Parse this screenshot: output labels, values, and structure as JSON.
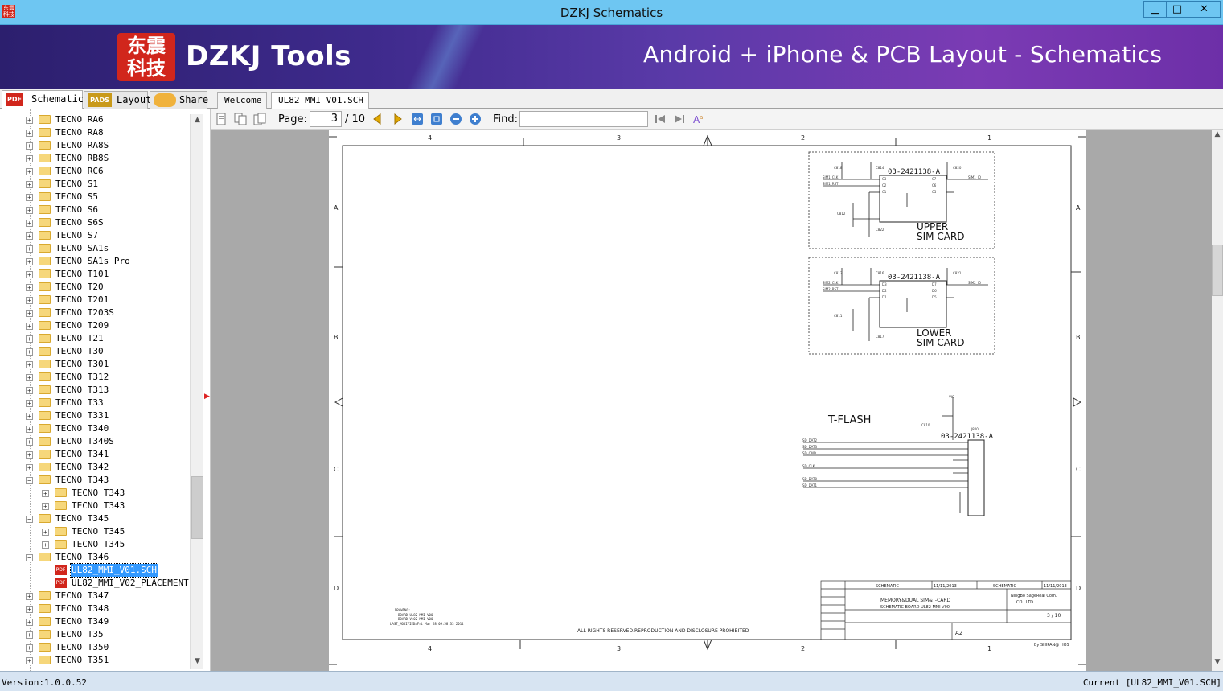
{
  "window": {
    "title": "DZKJ Schematics",
    "icon_text": "东震科技",
    "minimize": "▁",
    "maximize": "□",
    "close": "✕"
  },
  "banner": {
    "logo_text": "东震\n科技",
    "brand": "DZKJ Tools",
    "tagline": "Android + iPhone & PCB Layout - Schematics"
  },
  "left_tabs": [
    {
      "label": "Schematic",
      "icon": "pdf-icon",
      "icon_text": "PDF",
      "active": true
    },
    {
      "label": "Layout",
      "icon": "pads-icon",
      "icon_text": "PADS",
      "active": false
    },
    {
      "label": "Share",
      "icon": "cloud-share-icon",
      "icon_text": "",
      "active": false
    }
  ],
  "doc_tabs": [
    {
      "label": "Welcome",
      "active": false,
      "closable": false
    },
    {
      "label": "UL82_MMI_V01.SCH",
      "active": true,
      "closable": true
    }
  ],
  "tree": {
    "items": [
      {
        "label": "TECNO RA6",
        "level": 1,
        "type": "folder",
        "expand": "+"
      },
      {
        "label": "TECNO RA8",
        "level": 1,
        "type": "folder",
        "expand": "+"
      },
      {
        "label": "TECNO RA8S",
        "level": 1,
        "type": "folder",
        "expand": "+"
      },
      {
        "label": "TECNO RB8S",
        "level": 1,
        "type": "folder",
        "expand": "+"
      },
      {
        "label": "TECNO RC6",
        "level": 1,
        "type": "folder",
        "expand": "+"
      },
      {
        "label": "TECNO S1",
        "level": 1,
        "type": "folder",
        "expand": "+"
      },
      {
        "label": "TECNO S5",
        "level": 1,
        "type": "folder",
        "expand": "+"
      },
      {
        "label": "TECNO S6",
        "level": 1,
        "type": "folder",
        "expand": "+"
      },
      {
        "label": "TECNO S6S",
        "level": 1,
        "type": "folder",
        "expand": "+"
      },
      {
        "label": "TECNO S7",
        "level": 1,
        "type": "folder",
        "expand": "+"
      },
      {
        "label": "TECNO SA1s",
        "level": 1,
        "type": "folder",
        "expand": "+"
      },
      {
        "label": "TECNO SA1s Pro",
        "level": 1,
        "type": "folder",
        "expand": "+"
      },
      {
        "label": "TECNO T101",
        "level": 1,
        "type": "folder",
        "expand": "+"
      },
      {
        "label": "TECNO T20",
        "level": 1,
        "type": "folder",
        "expand": "+"
      },
      {
        "label": "TECNO T201",
        "level": 1,
        "type": "folder",
        "expand": "+"
      },
      {
        "label": "TECNO T203S",
        "level": 1,
        "type": "folder",
        "expand": "+"
      },
      {
        "label": "TECNO T209",
        "level": 1,
        "type": "folder",
        "expand": "+"
      },
      {
        "label": "TECNO T21",
        "level": 1,
        "type": "folder",
        "expand": "+"
      },
      {
        "label": "TECNO T30",
        "level": 1,
        "type": "folder",
        "expand": "+"
      },
      {
        "label": "TECNO T301",
        "level": 1,
        "type": "folder",
        "expand": "+"
      },
      {
        "label": "TECNO T312",
        "level": 1,
        "type": "folder",
        "expand": "+"
      },
      {
        "label": "TECNO T313",
        "level": 1,
        "type": "folder",
        "expand": "+"
      },
      {
        "label": "TECNO T33",
        "level": 1,
        "type": "folder",
        "expand": "+"
      },
      {
        "label": "TECNO T331",
        "level": 1,
        "type": "folder",
        "expand": "+"
      },
      {
        "label": "TECNO T340",
        "level": 1,
        "type": "folder",
        "expand": "+"
      },
      {
        "label": "TECNO T340S",
        "level": 1,
        "type": "folder",
        "expand": "+"
      },
      {
        "label": "TECNO T341",
        "level": 1,
        "type": "folder",
        "expand": "+"
      },
      {
        "label": "TECNO T342",
        "level": 1,
        "type": "folder",
        "expand": "+"
      },
      {
        "label": "TECNO T343",
        "level": 1,
        "type": "folder",
        "expand": "−"
      },
      {
        "label": "TECNO T343",
        "level": 2,
        "type": "folder",
        "expand": "+"
      },
      {
        "label": "TECNO T343",
        "level": 2,
        "type": "folder",
        "expand": "+"
      },
      {
        "label": "TECNO T345",
        "level": 1,
        "type": "folder",
        "expand": "−"
      },
      {
        "label": "TECNO T345",
        "level": 2,
        "type": "folder",
        "expand": "+"
      },
      {
        "label": "TECNO T345",
        "level": 2,
        "type": "folder",
        "expand": "+"
      },
      {
        "label": "TECNO T346",
        "level": 1,
        "type": "folder",
        "expand": "−"
      },
      {
        "label": "UL82_MMI_V01.SCH",
        "level": 2,
        "type": "pdf",
        "selected": true
      },
      {
        "label": "UL82_MMI_V02_PLACEMENT",
        "level": 2,
        "type": "pdf"
      },
      {
        "label": "TECNO T347",
        "level": 1,
        "type": "folder",
        "expand": "+"
      },
      {
        "label": "TECNO T348",
        "level": 1,
        "type": "folder",
        "expand": "+"
      },
      {
        "label": "TECNO T349",
        "level": 1,
        "type": "folder",
        "expand": "+"
      },
      {
        "label": "TECNO T35",
        "level": 1,
        "type": "folder",
        "expand": "+"
      },
      {
        "label": "TECNO T350",
        "level": 1,
        "type": "folder",
        "expand": "+"
      },
      {
        "label": "TECNO T351",
        "level": 1,
        "type": "folder",
        "expand": "+"
      }
    ]
  },
  "toolbar": {
    "page_label": "Page:",
    "page_current": "3",
    "page_total": "/ 10",
    "find_label": "Find:",
    "find_value": ""
  },
  "schematic": {
    "col_labels": [
      "4",
      "3",
      "2",
      "1"
    ],
    "row_labels": [
      "A",
      "B",
      "C",
      "D"
    ],
    "upper_part": "03-2421138-A",
    "upper_title_1": "UPPER",
    "upper_title_2": "SIM CARD",
    "lower_part": "03-2421138-A",
    "lower_title_1": "LOWER",
    "lower_title_2": "SIM CARD",
    "tflash_title": "T-FLASH",
    "tflash_part": "03-2421138-A",
    "copyright": "ALL RIGHTS RESERVED.REPRODUCTION AND DISCLOSURE PROHIBITED",
    "drawing_note_1": "DRAWING:",
    "drawing_note_2": "BOARD UL82 MMI V00",
    "drawing_note_3": "BOARD V:02 MMI V00",
    "drawing_note_4": "LAST_MODIFIED=Fri Mar 28 09:58:33 2014",
    "tb_name1": "SCHEMATIC",
    "tb_name2": "SCHEMATIC",
    "tb_date1": "11/11/2013",
    "tb_date2": "11/11/2013",
    "tb_title": "MEMORY&DUAL SIM&T-CARD",
    "tb_product": "SCHEMATIC BOARD UL82 MMI V00",
    "tb_company_1": "NingBo SageReal Com.",
    "tb_company_2": "CO., LTD.",
    "tb_page": "3 / 10",
    "tb_size": "A2",
    "tb_by": "By SHIPAN@ HOS"
  },
  "status": {
    "version": "Version:1.0.0.52",
    "current": "Current [UL82_MMI_V01.SCH]"
  },
  "colors": {
    "titlebar": "#6ec6f2",
    "selection": "#3399ff",
    "viewer_bg": "#a9a9a9"
  }
}
